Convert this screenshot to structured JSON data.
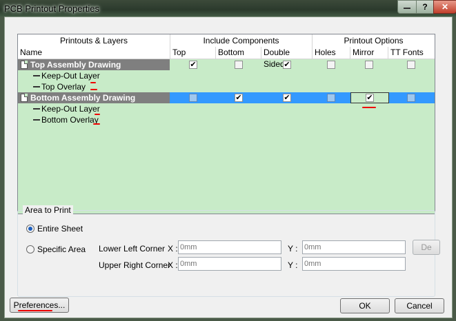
{
  "window": {
    "title": "PCB Printout Properties",
    "help_label": "?",
    "close_label": "✕"
  },
  "grid": {
    "group_headers": [
      "Printouts & Layers",
      "Include Components",
      "Printout Options"
    ],
    "columns": [
      "Name",
      "Top",
      "Bottom",
      "Double Sided",
      "Holes",
      "Mirror",
      "TT Fonts"
    ],
    "rows": [
      {
        "label": "Top Assembly Drawing",
        "type": "printout",
        "checks": [
          true,
          false,
          true,
          false,
          false,
          false
        ]
      },
      {
        "label": "Keep-Out Layer",
        "type": "layer"
      },
      {
        "label": "Top Overlay",
        "type": "layer"
      },
      {
        "label": "Bottom Assembly Drawing",
        "type": "printout",
        "checks": [
          false,
          true,
          true,
          false,
          true,
          false
        ]
      },
      {
        "label": "Keep-Out Layer",
        "type": "layer"
      },
      {
        "label": "Bottom Overlay",
        "type": "layer"
      }
    ]
  },
  "area": {
    "group_label": "Area to Print",
    "entire_sheet": "Entire Sheet",
    "specific_area": "Specific Area",
    "lower_left": "Lower Left Corner",
    "upper_right": "Upper Right Corner",
    "x_label": "X :",
    "y_label": "Y :",
    "placeholder": "0mm",
    "define_label": "De",
    "selected": "Entire Sheet"
  },
  "buttons": {
    "preferences": "Preferences...",
    "ok": "OK",
    "cancel": "Cancel"
  },
  "check_glyph": "✔"
}
